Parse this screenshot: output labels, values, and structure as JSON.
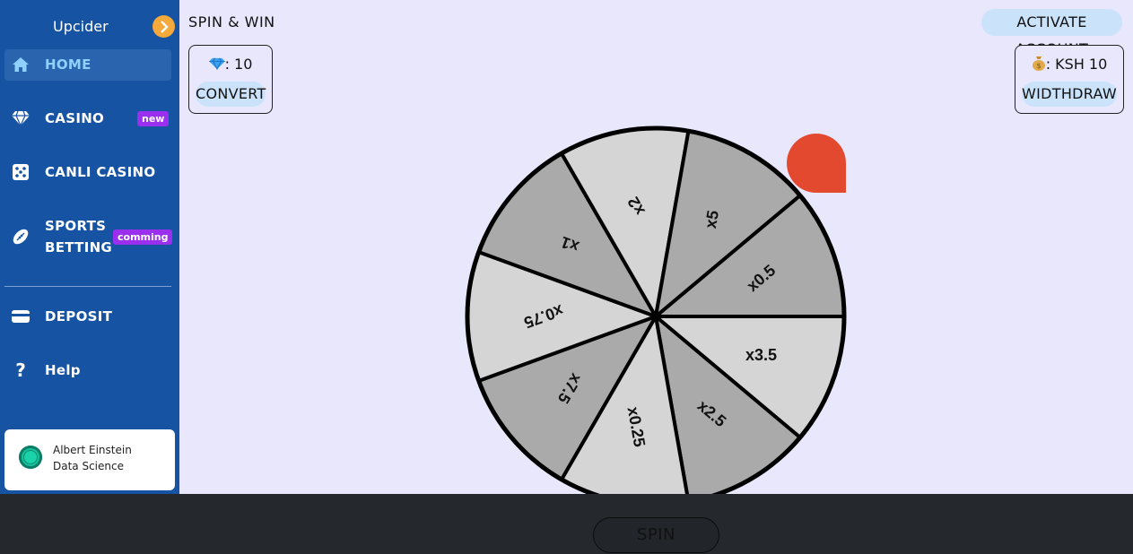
{
  "sidebar": {
    "brand": "Upcider",
    "items": [
      {
        "label": "HOME",
        "icon": "home-icon"
      },
      {
        "label": "CASINO",
        "icon": "diamond-icon",
        "badge": "new"
      },
      {
        "label": "CANLI CASINO",
        "icon": "dice-icon"
      },
      {
        "label_line1": "SPORTS",
        "label_line2": "BETTING",
        "icon": "football-icon",
        "badge": "comming"
      },
      {
        "label": "DEPOSIT",
        "icon": "wallet-icon"
      },
      {
        "label": "Help",
        "icon": "question-icon"
      }
    ],
    "user": {
      "name": "Albert Einstein",
      "role": "Data Science"
    }
  },
  "header": {
    "title": "SPIN & WIN",
    "activate_label": "ACTIVATE ACCOUNT"
  },
  "gems": {
    "text": ": 10",
    "convert_label": "CONVERT",
    "icon": "gem-icon"
  },
  "cash": {
    "text": ": KSH 10",
    "withdraw_label": "WIDTHDRAW",
    "icon": "money-bag-icon"
  },
  "wheel": {
    "segments": [
      "x0.5",
      "x3.5",
      "x2.5",
      "x0.25",
      "x7.5",
      "x0.75",
      "x1",
      "x2",
      "x5"
    ],
    "colors": {
      "dark": "#aaaaaa",
      "light": "#d5d5d5",
      "pointer": "#e2492e"
    }
  },
  "bottom": {
    "spin_label": "SPIN"
  },
  "colors": {
    "sidebar": "#1653a3",
    "accent": "#cbe2fb",
    "badge": "#9b2ff0",
    "page_bg": "#e8e7fc"
  }
}
